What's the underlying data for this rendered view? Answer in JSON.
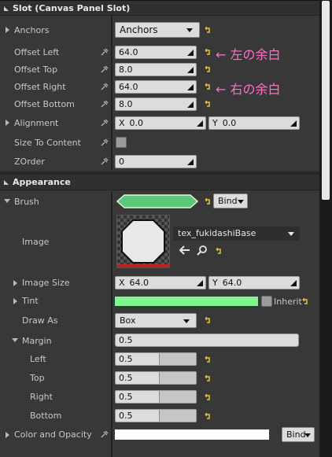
{
  "slot": {
    "title": "Slot (Canvas Panel Slot)",
    "anchors": {
      "label": "Anchors",
      "value": "Anchors"
    },
    "offset_left": {
      "label": "Offset Left",
      "value": "64.0"
    },
    "offset_top": {
      "label": "Offset Top",
      "value": "8.0"
    },
    "offset_right": {
      "label": "Offset Right",
      "value": "64.0"
    },
    "offset_bottom": {
      "label": "Offset Bottom",
      "value": "8.0"
    },
    "alignment": {
      "label": "Alignment",
      "x_label": "X",
      "x": "0.0",
      "y_label": "Y",
      "y": "0.0"
    },
    "size_to_content": {
      "label": "Size To Content",
      "checked": false
    },
    "zorder": {
      "label": "ZOrder",
      "value": "0"
    },
    "note_left": "← 左の余白",
    "note_right": "← 右の余白"
  },
  "appearance": {
    "title": "Appearance",
    "brush": {
      "label": "Brush",
      "bind": "Bind",
      "color": "#5ec77a"
    },
    "image": {
      "label": "Image",
      "texture": "tex_fukidashiBase"
    },
    "image_size": {
      "label": "Image Size",
      "x_label": "X",
      "x": "64.0",
      "y_label": "Y",
      "y": "64.0"
    },
    "tint": {
      "label": "Tint",
      "color": "#7ef58d",
      "inherit": "Inherit"
    },
    "draw_as": {
      "label": "Draw As",
      "value": "Box"
    },
    "margin": {
      "label": "Margin",
      "value": "0.5"
    },
    "margin_left": {
      "label": "Left",
      "value": "0.5"
    },
    "margin_top": {
      "label": "Top",
      "value": "0.5"
    },
    "margin_right": {
      "label": "Right",
      "value": "0.5"
    },
    "margin_bottom": {
      "label": "Bottom",
      "value": "0.5"
    },
    "color_opacity": {
      "label": "Color and Opacity",
      "color": "#ffffff",
      "bind": "Bind"
    }
  }
}
